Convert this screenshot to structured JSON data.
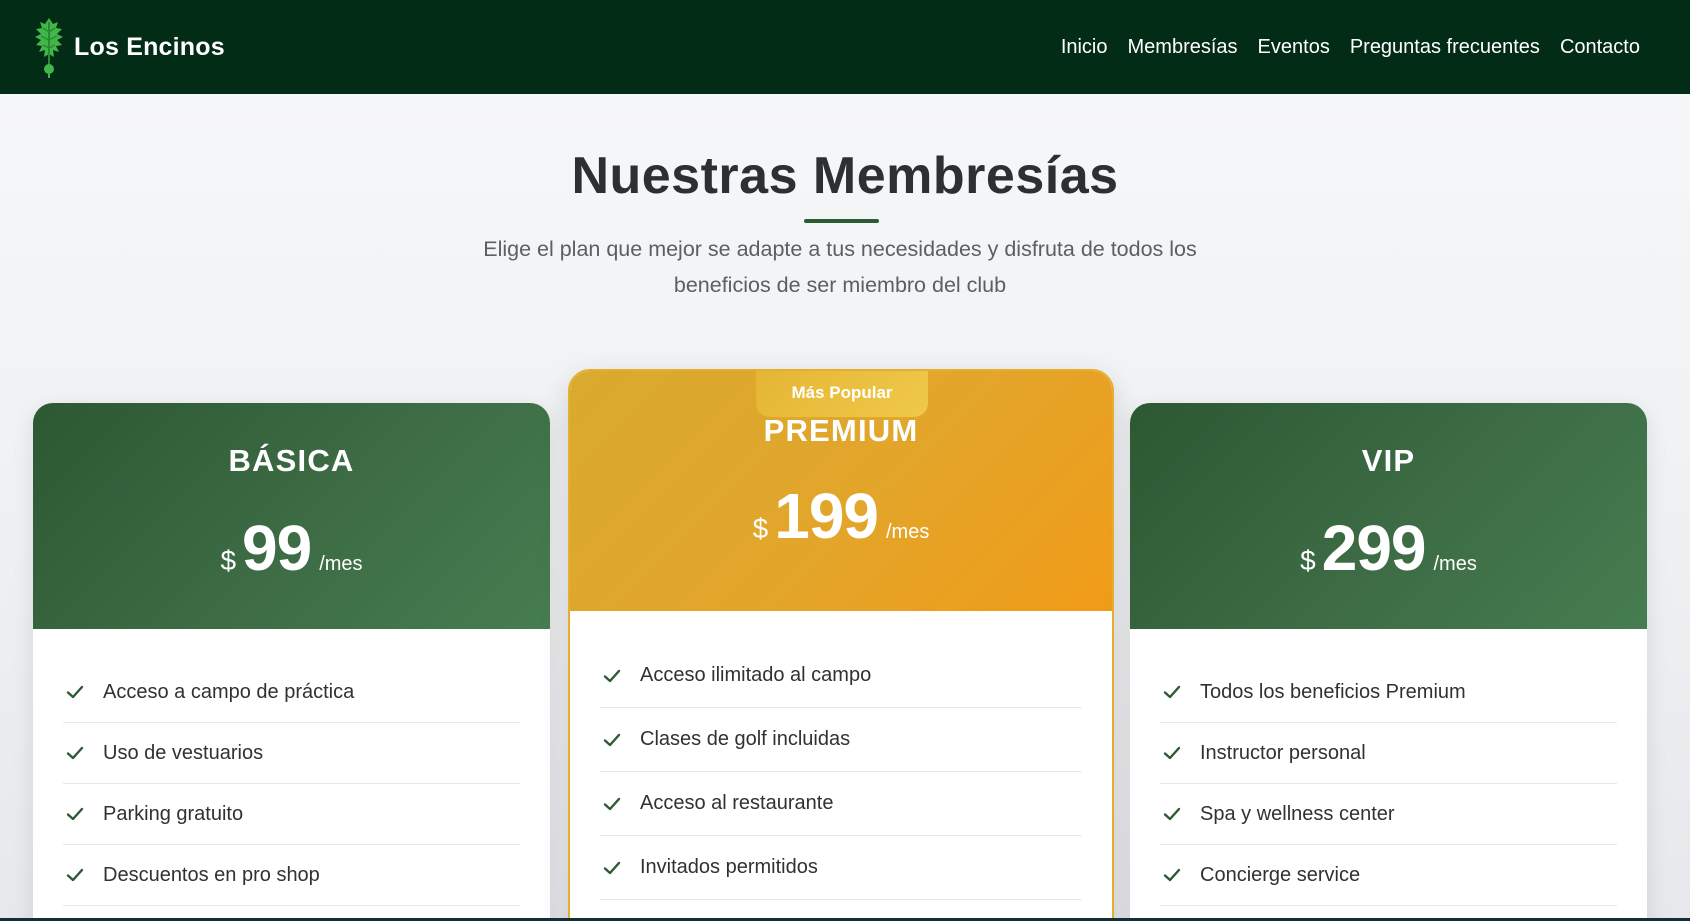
{
  "header": {
    "brand": "Los Encinos",
    "logo_icon": "oak-leaf-icon",
    "nav": [
      {
        "label": "Inicio"
      },
      {
        "label": "Membresías"
      },
      {
        "label": "Eventos"
      },
      {
        "label": "Preguntas frecuentes"
      },
      {
        "label": "Contacto"
      }
    ]
  },
  "section": {
    "title": "Nuestras Membresías",
    "subtitle": "Elige el plan que mejor se adapte a tus necesidades y disfruta de todos los beneficios de ser miembro del club"
  },
  "plans": {
    "basica": {
      "name": "BÁSICA",
      "currency": "$",
      "amount": "99",
      "period": "/mes",
      "features": [
        "Acceso a campo de práctica",
        "Uso de vestuarios",
        "Parking gratuito",
        "Descuentos en pro shop"
      ]
    },
    "premium": {
      "badge": "Más Popular",
      "name": "PREMIUM",
      "currency": "$",
      "amount": "199",
      "period": "/mes",
      "features": [
        "Acceso ilimitado al campo",
        "Clases de golf incluidas",
        "Acceso al restaurante",
        "Invitados permitidos"
      ]
    },
    "vip": {
      "name": "VIP",
      "currency": "$",
      "amount": "299",
      "period": "/mes",
      "features": [
        "Todos los beneficios Premium",
        "Instructor personal",
        "Spa y wellness center",
        "Concierge service"
      ]
    }
  },
  "colors": {
    "header_bg": "#032c17",
    "green_accent": "#2c5a33",
    "gold_accent": "#e8a523",
    "check_color": "#2c5a33"
  }
}
